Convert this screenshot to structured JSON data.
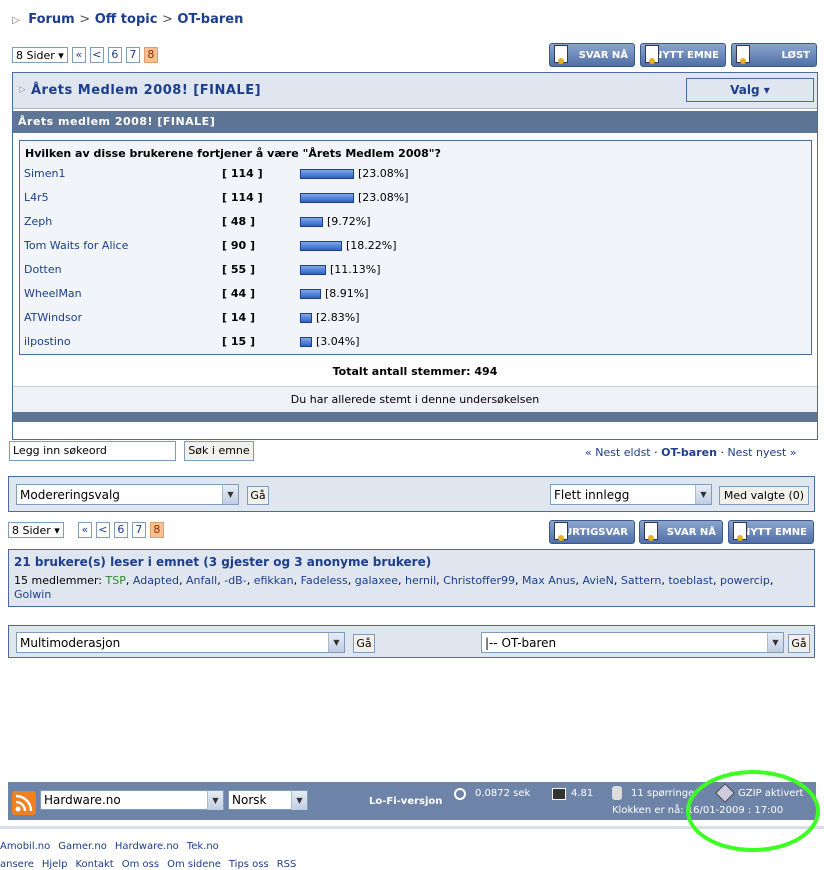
{
  "breadcrumb": {
    "items": [
      "Forum",
      "Off topic",
      "OT-baren"
    ],
    "sep": ">"
  },
  "pager_top": {
    "pages_label": "8 Sider",
    "buttons": [
      "«",
      "<",
      "6",
      "7",
      "8"
    ],
    "current": "8"
  },
  "actions_top": [
    "SVAR NÅ",
    "NYTT EMNE",
    "LØST"
  ],
  "thread": {
    "title": "Årets Medlem 2008! [FINALE]",
    "valg": "Valg ▾"
  },
  "poll": {
    "header": "Årets medlem 2008! [FINALE]",
    "question": "Hvilken av disse brukerene fortjener å være \"Årets Medlem 2008\"?",
    "options": [
      {
        "name": "Simen1",
        "votes": "[ 114 ]",
        "pct": "[23.08%]",
        "fraction": 0.2308
      },
      {
        "name": "L4r5",
        "votes": "[ 114 ]",
        "pct": "[23.08%]",
        "fraction": 0.2308
      },
      {
        "name": "Zeph",
        "votes": "[ 48 ]",
        "pct": "[9.72%]",
        "fraction": 0.0972
      },
      {
        "name": "Tom Waits for Alice",
        "votes": "[ 90 ]",
        "pct": "[18.22%]",
        "fraction": 0.1822
      },
      {
        "name": "Dotten",
        "votes": "[ 55 ]",
        "pct": "[11.13%]",
        "fraction": 0.1113
      },
      {
        "name": "WheelMan",
        "votes": "[ 44 ]",
        "pct": "[8.91%]",
        "fraction": 0.0891
      },
      {
        "name": "ATWindsor",
        "votes": "[ 14 ]",
        "pct": "[2.83%]",
        "fraction": 0.0283
      },
      {
        "name": "ilpostino",
        "votes": "[ 15 ]",
        "pct": "[3.04%]",
        "fraction": 0.0304
      }
    ],
    "total": "Totalt antall stemmer: 494",
    "notice": "Du har allerede stemt i denne undersøkelsen"
  },
  "search": {
    "placeholder": "Legg inn søkeord",
    "button": "Søk i emne"
  },
  "thread_nav": {
    "prev": "« Nest eldst",
    "current": "OT-baren",
    "next": "Nest nyest »",
    "sep": "·"
  },
  "moderation": {
    "select": "Modereringsvalg",
    "go": "Gå",
    "merge": "Flett innlegg",
    "selected": "Med valgte (0)"
  },
  "pager_bottom": {
    "pages_label": "8 Sider",
    "buttons": [
      "«",
      "<",
      "6",
      "7",
      "8"
    ],
    "current": "8"
  },
  "actions_bottom": [
    "HURTIGSVAR",
    "SVAR NÅ",
    "NYTT EMNE"
  ],
  "readers": {
    "head": "21 brukere(s) leser i emnet (3 gjester og 3 anonyme brukere)",
    "label": "15 medlemmer:",
    "members": [
      "TSP",
      "Adapted",
      "Anfall",
      "-dB-",
      "efikkan",
      "Fadeless",
      "galaxee",
      "hernil",
      "Christoffer99",
      "Max Anus",
      "AvieN",
      "Sattern",
      "toeblast",
      "powercip",
      "Golwin"
    ],
    "first_color": "#2a8a2a"
  },
  "multimod": {
    "select": "Multimoderasjon",
    "go": "Gå",
    "forum": "|-- OT-baren",
    "go2": "Gå"
  },
  "footer": {
    "site": "Hardware.no",
    "lang": "Norsk",
    "lofi": "Lo-Fi-versjon",
    "time": "0.0872 sek",
    "load": "4.81",
    "queries": "11 spørringer",
    "gzip": "GZIP aktivert",
    "clock": "Klokken er nå: 16/01-2009 : 17:00"
  },
  "bottom_links_1": [
    "Amobil.no",
    "Gamer.no",
    "Hardware.no",
    "Tek.no"
  ],
  "bottom_links_2": [
    "ansere",
    "Hjelp",
    "Kontakt",
    "Om oss",
    "Om sidene",
    "Tips oss",
    "RSS"
  ],
  "colors": {
    "accent": "#1c3e8c",
    "highlight": "#3cff22"
  }
}
